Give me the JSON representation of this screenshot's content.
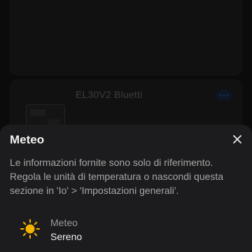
{
  "background": {
    "device_card": {
      "device_name": "EL30V2 Bluetti"
    }
  },
  "sheet": {
    "title": "Meteo",
    "close_icon": "close-icon",
    "info_text": "Le informazioni fornite sono solo di riferimento. Regola le unità di temperatura o nascondi questa sezione in 'Io' > 'Impostazioni generali'.",
    "weather": {
      "icon": "sun-icon",
      "label": "Meteo",
      "value": "Sereno"
    }
  },
  "colors": {
    "sheet_background": "#1c1c1e",
    "sun": "#f4b400",
    "text_primary": "#f2f2f2",
    "text_secondary": "#a7a7a7"
  }
}
